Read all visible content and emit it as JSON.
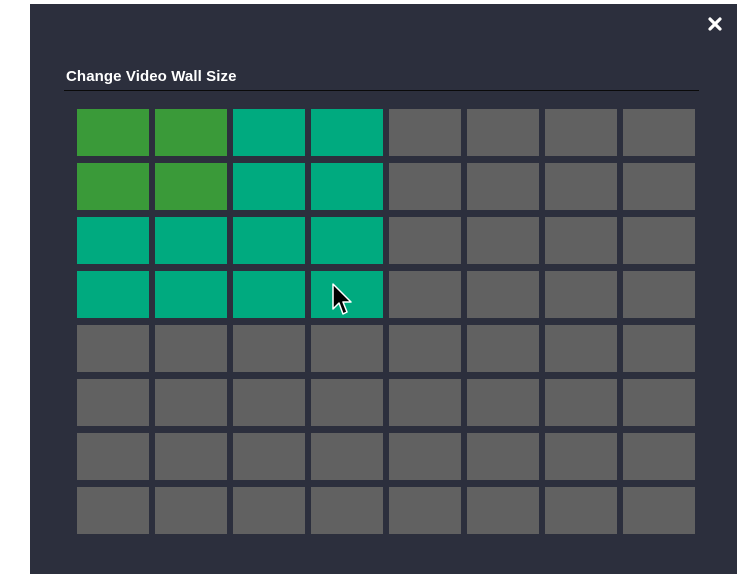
{
  "dialog": {
    "title": "Change Video Wall Size",
    "close_icon": "close-icon"
  },
  "grid": {
    "rows": 8,
    "cols": 8,
    "current_size": {
      "rows": 2,
      "cols": 2
    },
    "hover_size": {
      "rows": 4,
      "cols": 4
    }
  },
  "colors": {
    "dialog_bg": "#2c2f3d",
    "current": "#3a9a39",
    "hover": "#00aa7f",
    "empty": "#616161",
    "title": "#ffffff"
  },
  "pointer_icon": "mouse-pointer-icon"
}
